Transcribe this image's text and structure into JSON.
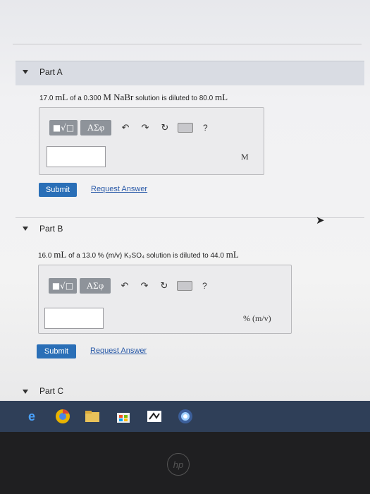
{
  "part_a": {
    "title": "Part A",
    "question_pre": "17.0",
    "question_unit1": "mL",
    "question_mid": "of a 0.300",
    "question_chem": "M NaBr",
    "question_post": "solution is diluted to 80.0",
    "question_unit2": "mL",
    "unit": "M",
    "submit": "Submit",
    "request": "Request Answer"
  },
  "part_b": {
    "title": "Part B",
    "question_pre": "16.0",
    "question_unit1": "mL",
    "question_mid": "of a 13.0 % (m/v) K₂SO₄",
    "question_post": "solution is diluted to 44.0",
    "question_unit2": "mL",
    "unit": "% (m/v)",
    "submit": "Submit",
    "request": "Request Answer"
  },
  "part_c": {
    "title": "Part C"
  },
  "toolbar": {
    "root_label": "■√□",
    "greek_label": "ΑΣφ",
    "undo": "↶",
    "redo": "↷",
    "reset": "↻",
    "help": "?"
  },
  "taskbar": {
    "icons": [
      "edge-icon",
      "chrome-icon",
      "file-explorer-icon",
      "store-icon",
      "app-icon",
      "media-icon"
    ]
  },
  "brand": {
    "laptop": "hp"
  }
}
